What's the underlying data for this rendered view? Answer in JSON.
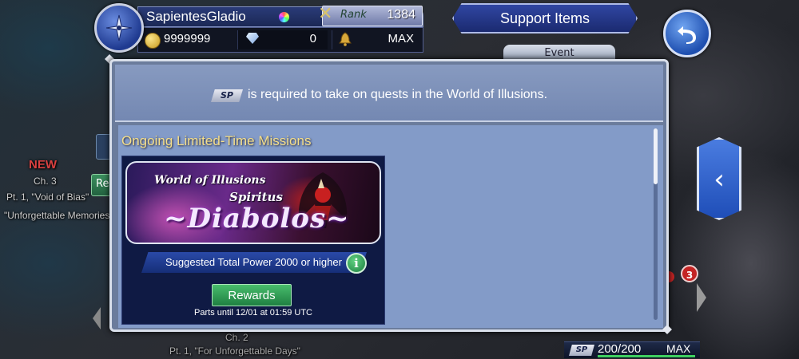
{
  "player": {
    "name": "SapientesGladio",
    "rank_label": "Rank",
    "rank": "1384",
    "gil": "9999999",
    "gems": "0",
    "stamina": "MAX"
  },
  "header": {
    "support_items_label": "Support Items"
  },
  "map": {
    "new_label": "NEW",
    "chapter": "Ch. 3",
    "part": "Pt. 1, \"Void of Bias\"",
    "subtitle": "\"Unforgettable Memories",
    "chapter2": "Ch. 2",
    "part2": "Pt. 1, \"For Unforgettable Days\"",
    "reward_stub": "Re",
    "event_tab": "Event",
    "badge_count": "3"
  },
  "dialog": {
    "sp_badge": "SP",
    "message": "is required to take on quests in the World of Illusions.",
    "section_title": "Ongoing Limited-Time Missions",
    "event": {
      "banner_line1": "World of Illusions",
      "banner_line2": "Spiritus",
      "banner_line3": "~Diabolos~",
      "suggested_power": "Suggested Total Power 2000 or higher",
      "info_glyph": "i",
      "rewards_label": "Rewards",
      "parts_until": "Parts until 12/01 at 01:59 UTC"
    },
    "scroll_position": 0
  },
  "side_toggle": {
    "glyph": "‹"
  },
  "sp_footer": {
    "badge": "SP",
    "value": "200/200",
    "max_label": "MAX",
    "fill_fraction": 1.0
  },
  "colors": {
    "accent_blue": "#1f4eb8",
    "gold_text": "#f5df8a",
    "rewards_green": "#1f7f42",
    "dialog_body": "#839bc8"
  },
  "icons": {
    "avatar": "crest-icon",
    "gil": "gil-coin-icon",
    "gems": "gem-icon",
    "stamina": "bell-icon",
    "back": "return-arrow-icon",
    "info": "info-icon",
    "side": "chevron-left-icon"
  }
}
